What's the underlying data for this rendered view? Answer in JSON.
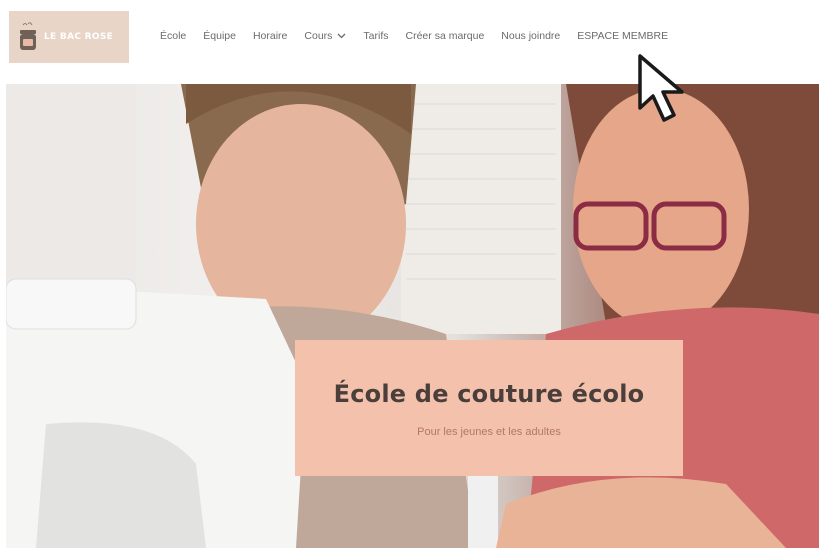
{
  "brand": {
    "name": "LE BAC ROSE",
    "bg_color": "#e8d5c8"
  },
  "nav": {
    "items": [
      {
        "label": "École"
      },
      {
        "label": "Équipe"
      },
      {
        "label": "Horaire"
      },
      {
        "label": "Cours",
        "has_dropdown": true
      },
      {
        "label": "Tarifs"
      },
      {
        "label": "Créer sa marque"
      },
      {
        "label": "Nous joindre"
      },
      {
        "label": "ESPACE MEMBRE"
      }
    ],
    "dropdown_icon": "chevron-down-icon"
  },
  "hero": {
    "title": "École de couture écolo",
    "subtitle": "Pour les jeunes et les adultes",
    "card_color": "#f4c1ac"
  },
  "cursor": {
    "icon": "mouse-pointer-icon"
  }
}
